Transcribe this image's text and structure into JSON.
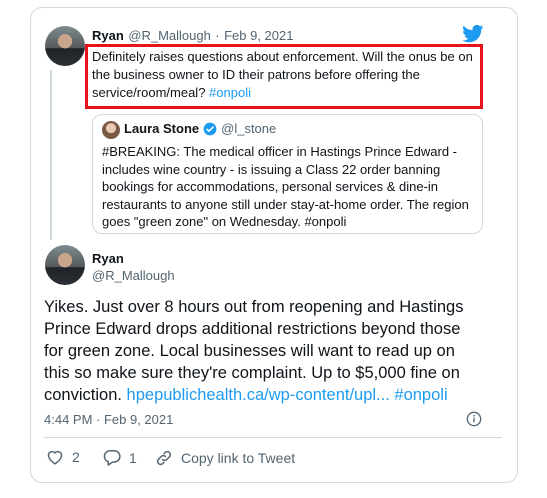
{
  "reply_tweet": {
    "name": "Ryan",
    "handle": "@R_Mallough",
    "separator": "·",
    "date": "Feb 9, 2021",
    "text_plain": "Definitely raises questions about enforcement. Will the onus be on the business owner to ID their patrons before offering the service/room/meal? ",
    "hashtag": "#onpoli"
  },
  "quote_tweet": {
    "name": "Laura Stone",
    "handle": "@l_stone",
    "text": "#BREAKING: The medical officer in Hastings Prince Edward - includes wine country - is issuing a Class 22 order banning bookings for accommodations, personal services & dine-in restaurants to anyone still under stay-at-home order. The region goes \"green zone\" on Wednesday. #onpoli"
  },
  "main_tweet": {
    "name": "Ryan",
    "handle": "@R_Mallough",
    "text_plain": "Yikes. Just over 8 hours out from reopening and Hastings Prince Edward drops additional restrictions beyond those for green zone. Local businesses will want to read up on this so make sure they're complaint. Up to $5,000 fine on conviction. ",
    "link": "hpepublichealth.ca/wp-content/upl...",
    "hashtag": "#onpoli",
    "timestamp": "4:44 PM · Feb 9, 2021"
  },
  "actions": {
    "like_count": "2",
    "reply_count": "1",
    "copy_link_label": "Copy link to Tweet"
  },
  "colors": {
    "accent": "#1d9bf0",
    "highlight": "#e8141b",
    "verified": "#1d9bf0"
  },
  "icons": [
    "twitter-bird-icon",
    "verified-badge-icon",
    "info-icon",
    "heart-icon",
    "reply-icon",
    "link-icon"
  ]
}
